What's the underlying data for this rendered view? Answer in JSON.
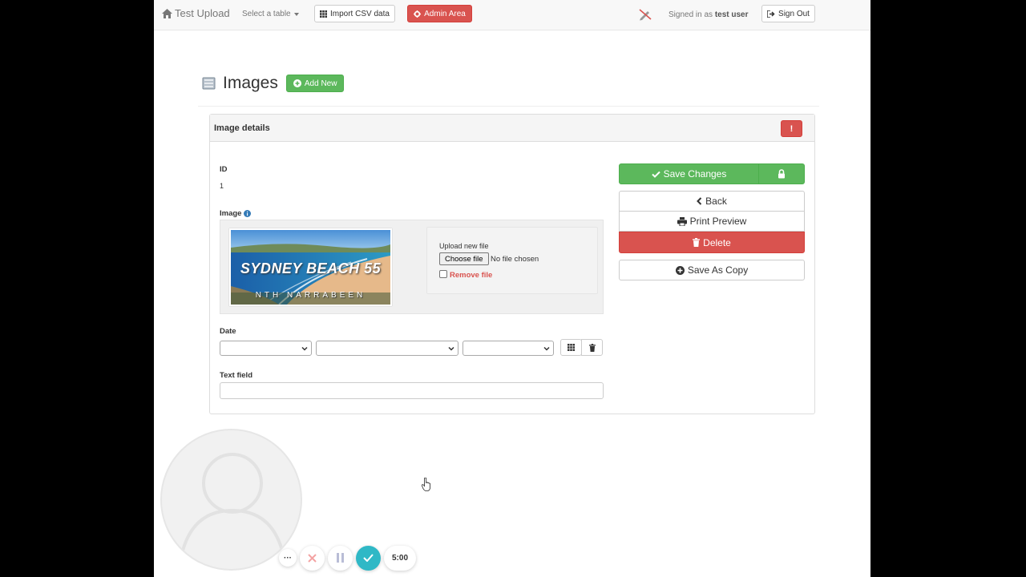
{
  "navbar": {
    "brand": "Test Upload",
    "select_table": "Select a table",
    "import_csv": "Import CSV data",
    "admin_area": "Admin Area",
    "signed_in_prefix": "Signed in as",
    "username": "test user",
    "sign_out": "Sign Out"
  },
  "header": {
    "title": "Images",
    "add_new": "Add New"
  },
  "panel": {
    "title": "Image details",
    "alert_label": "!"
  },
  "fields": {
    "id_label": "ID",
    "id_value": "1",
    "image_label": "Image",
    "image_overlay_title": "SYDNEY BEACH 55",
    "image_overlay_subtitle": "NTH NARRABEEN",
    "upload_label": "Upload new file",
    "choose_file": "Choose file",
    "no_file": "No file chosen",
    "remove_file": "Remove file",
    "date_label": "Date",
    "date_day": "",
    "date_month": "",
    "date_year": "",
    "text_field_label": "Text field",
    "text_field_value": ""
  },
  "actions": {
    "save_changes": "Save Changes",
    "back": "Back",
    "print_preview": "Print Preview",
    "delete": "Delete",
    "save_as_copy": "Save As Copy"
  },
  "recorder": {
    "more": "···",
    "timer": "5:00"
  },
  "colors": {
    "success": "#5cb85c",
    "danger": "#d9534f",
    "recorder_accent": "#2fb8c6"
  }
}
